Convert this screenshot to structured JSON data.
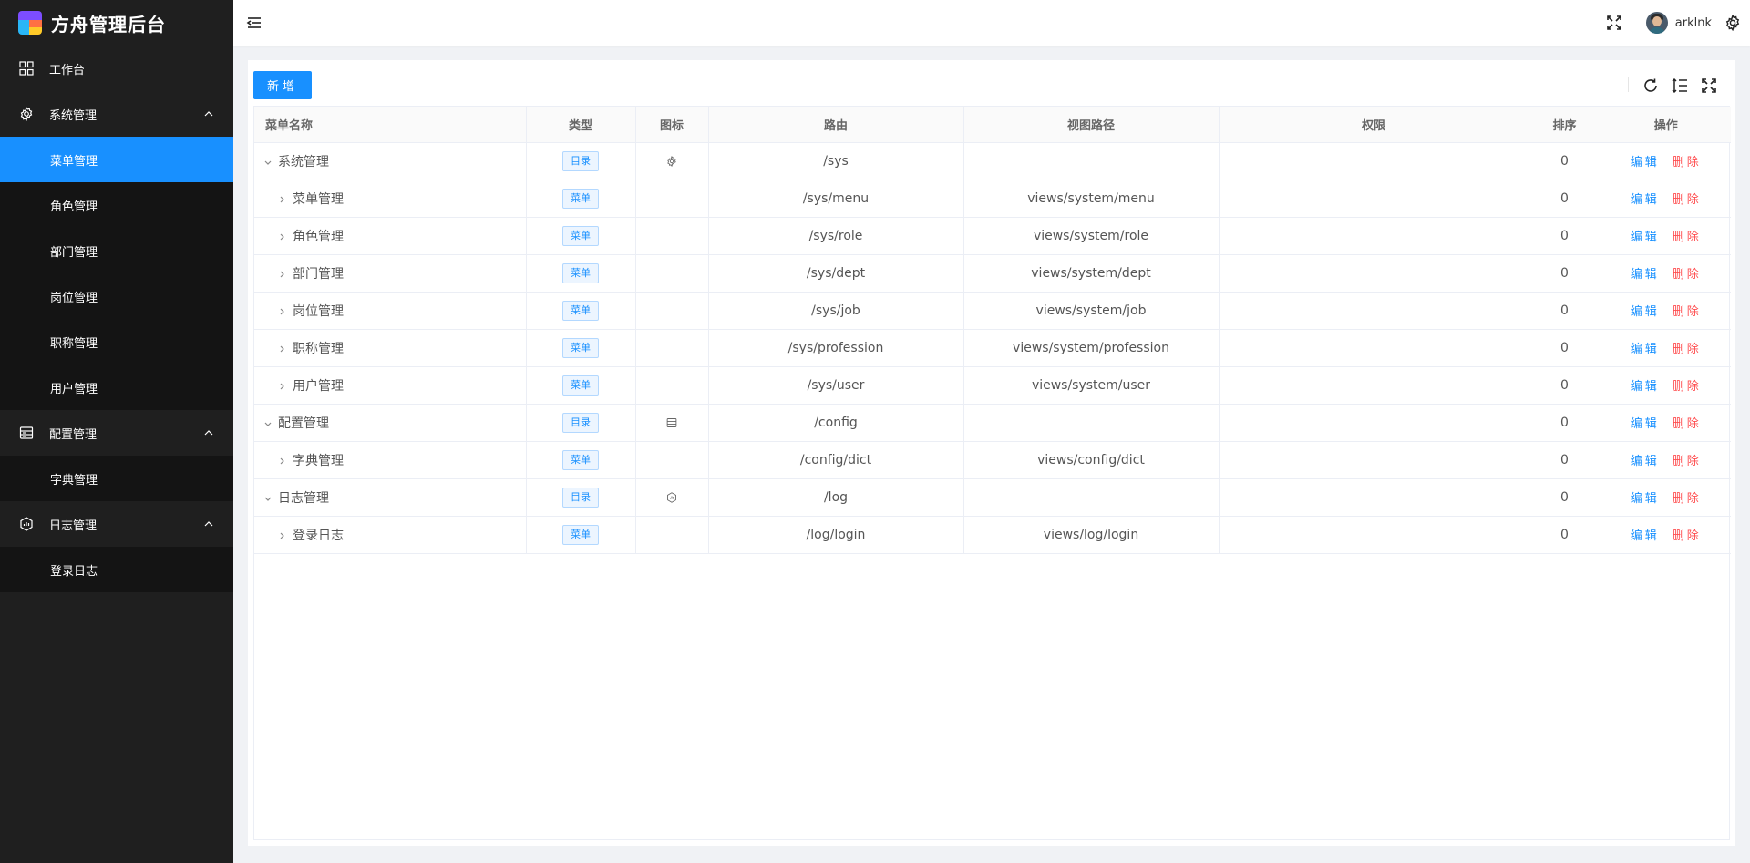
{
  "app": {
    "title": "方舟管理后台"
  },
  "sidebar": {
    "items": [
      {
        "label": "工作台",
        "icon": "dashboard-icon"
      },
      {
        "label": "系统管理",
        "icon": "gear-icon",
        "children": [
          "菜单管理",
          "角色管理",
          "部门管理",
          "岗位管理",
          "职称管理",
          "用户管理"
        ]
      },
      {
        "label": "配置管理",
        "icon": "config-icon",
        "children": [
          "字典管理"
        ]
      },
      {
        "label": "日志管理",
        "icon": "log-icon",
        "children": [
          "登录日志"
        ]
      }
    ],
    "active": "菜单管理"
  },
  "header": {
    "username": "arklnk"
  },
  "toolbar": {
    "add_label": "新增"
  },
  "table": {
    "columns": [
      "菜单名称",
      "类型",
      "图标",
      "路由",
      "视图路径",
      "权限",
      "排序",
      "操作"
    ],
    "edit_label": "编辑",
    "delete_label": "删除",
    "rows": [
      {
        "name": "系统管理",
        "type": "目录",
        "icon": "gear-icon",
        "route": "/sys",
        "view": "",
        "perm": "",
        "sort": "0",
        "level": 0
      },
      {
        "name": "菜单管理",
        "type": "菜单",
        "icon": "",
        "route": "/sys/menu",
        "view": "views/system/menu",
        "perm": "",
        "sort": "0",
        "level": 1
      },
      {
        "name": "角色管理",
        "type": "菜单",
        "icon": "",
        "route": "/sys/role",
        "view": "views/system/role",
        "perm": "",
        "sort": "0",
        "level": 1
      },
      {
        "name": "部门管理",
        "type": "菜单",
        "icon": "",
        "route": "/sys/dept",
        "view": "views/system/dept",
        "perm": "",
        "sort": "0",
        "level": 1
      },
      {
        "name": "岗位管理",
        "type": "菜单",
        "icon": "",
        "route": "/sys/job",
        "view": "views/system/job",
        "perm": "",
        "sort": "0",
        "level": 1
      },
      {
        "name": "职称管理",
        "type": "菜单",
        "icon": "",
        "route": "/sys/profession",
        "view": "views/system/profession",
        "perm": "",
        "sort": "0",
        "level": 1
      },
      {
        "name": "用户管理",
        "type": "菜单",
        "icon": "",
        "route": "/sys/user",
        "view": "views/system/user",
        "perm": "",
        "sort": "0",
        "level": 1
      },
      {
        "name": "配置管理",
        "type": "目录",
        "icon": "config-icon",
        "route": "/config",
        "view": "",
        "perm": "",
        "sort": "0",
        "level": 0
      },
      {
        "name": "字典管理",
        "type": "菜单",
        "icon": "",
        "route": "/config/dict",
        "view": "views/config/dict",
        "perm": "",
        "sort": "0",
        "level": 1
      },
      {
        "name": "日志管理",
        "type": "目录",
        "icon": "log-icon",
        "route": "/log",
        "view": "",
        "perm": "",
        "sort": "0",
        "level": 0
      },
      {
        "name": "登录日志",
        "type": "菜单",
        "icon": "",
        "route": "/log/login",
        "view": "views/log/login",
        "perm": "",
        "sort": "0",
        "level": 1
      }
    ]
  }
}
